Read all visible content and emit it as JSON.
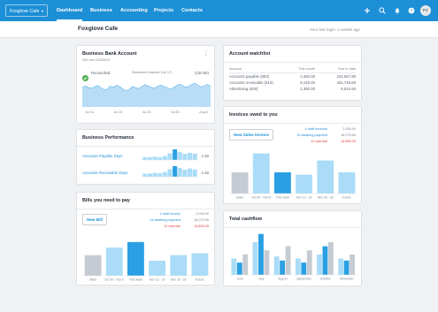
{
  "topbar": {
    "org_button": "Foxglove Cafe",
    "nav": [
      "Dashboard",
      "Business",
      "Accounting",
      "Projects",
      "Contacts"
    ],
    "avatar_initials": "FC"
  },
  "orgbar": {
    "title": "Foxglove Cafe",
    "last_login": "Your last login: 2 weeks ago"
  },
  "bank": {
    "title": "Business Bank Account",
    "account_number": "306-0m-12345678",
    "reconciled": "Reconciled",
    "statement_label": "Statement balance (Jul 17)",
    "statement_value": "(130.60)",
    "chart_data": {
      "type": "area",
      "x_ticks": [
        "Jul 16",
        "Jul 20",
        "Jul 23",
        "Jul 25",
        "Aug 6"
      ],
      "values": [
        58,
        62,
        57,
        55,
        60,
        63,
        56,
        50,
        52,
        61,
        58,
        64,
        60,
        52,
        48,
        51,
        60,
        57,
        54,
        60,
        66,
        62,
        58,
        55,
        60,
        64,
        61,
        57,
        52,
        56,
        62,
        67,
        63,
        58,
        61,
        66,
        70,
        64,
        59,
        62,
        66,
        60
      ],
      "color": "#b9ddf6"
    }
  },
  "performance": {
    "title": "Business Performance",
    "rows": [
      {
        "label": "Accounts Payable Days",
        "value": "1.60",
        "spark": [
          1,
          1,
          1.2,
          1,
          1.4,
          2.4,
          3.8,
          2.8,
          2.2,
          2.6,
          2.3
        ]
      },
      {
        "label": "Accounts Receivable Days",
        "value": "1.60",
        "spark": [
          1,
          1.1,
          1.3,
          1.2,
          1.6,
          2.6,
          3.6,
          3,
          2.4,
          2.8,
          2.5
        ]
      }
    ]
  },
  "bills": {
    "title": "Bills you need to pay",
    "button": "New Bill",
    "lines": [
      {
        "label": "1 draft invoice",
        "value": "2,006.00"
      },
      {
        "label": "14 awaiting payment",
        "value": "18,075.65"
      },
      {
        "label": "11 overdue",
        "value": "14,653.20"
      }
    ],
    "chart_data": {
      "type": "bar",
      "categories": [
        "Older",
        "Oct 30 - Nov 5",
        "This week",
        "Nov 13 - 19",
        "Nov 20 - 26",
        "Future"
      ],
      "values": [
        11,
        15,
        18,
        8,
        11,
        12
      ],
      "colors": [
        "#c5cbd3",
        "#aadcf7",
        "#2b9fe3",
        "#aadcf7",
        "#aadcf7",
        "#aadcf7"
      ]
    }
  },
  "watchlist": {
    "title": "Account watchlist",
    "headers": [
      "Account",
      "This month",
      "Year to date"
    ],
    "rows": [
      [
        "Accounts payable (800)",
        "2,450.00",
        "234,567.80"
      ],
      [
        "Accounts receivable (610)",
        "8,145.00",
        "432,748.80"
      ],
      [
        "Advertising (400)",
        "1,350.00",
        "8,524.50"
      ]
    ]
  },
  "invoices": {
    "title": "Invoices owed to you",
    "button": "New Sales Invoice",
    "lines": [
      {
        "label": "4 draft invoices",
        "value": "2,056.00"
      },
      {
        "label": "15 awaiting payment",
        "value": "18,075.65"
      },
      {
        "label": "11 overdue",
        "value": "14,653.20"
      }
    ],
    "chart_data": {
      "type": "bar",
      "categories": [
        "Older",
        "Oct 30 - Nov 5",
        "This week",
        "Nov 13 - 19",
        "Nov 20 - 26",
        "Future"
      ],
      "values": [
        9,
        17,
        9,
        8,
        14,
        9
      ],
      "colors": [
        "#c5cbd3",
        "#aadcf7",
        "#2b9fe3",
        "#aadcf7",
        "#aadcf7",
        "#aadcf7"
      ]
    }
  },
  "cashflow": {
    "title": "Total cashflow",
    "chart_data": {
      "type": "bar",
      "categories": [
        "June",
        "July",
        "August",
        "September",
        "October",
        "November"
      ],
      "series": [
        {
          "values": [
            8,
            16,
            9,
            8,
            10,
            8
          ],
          "color": "#aadcf7"
        },
        {
          "values": [
            6,
            20,
            7,
            6,
            14,
            7
          ],
          "color": "#2b9fe3"
        },
        {
          "values": [
            10,
            12,
            14,
            12,
            16,
            10
          ],
          "color": "#c5cbd3"
        }
      ]
    }
  }
}
